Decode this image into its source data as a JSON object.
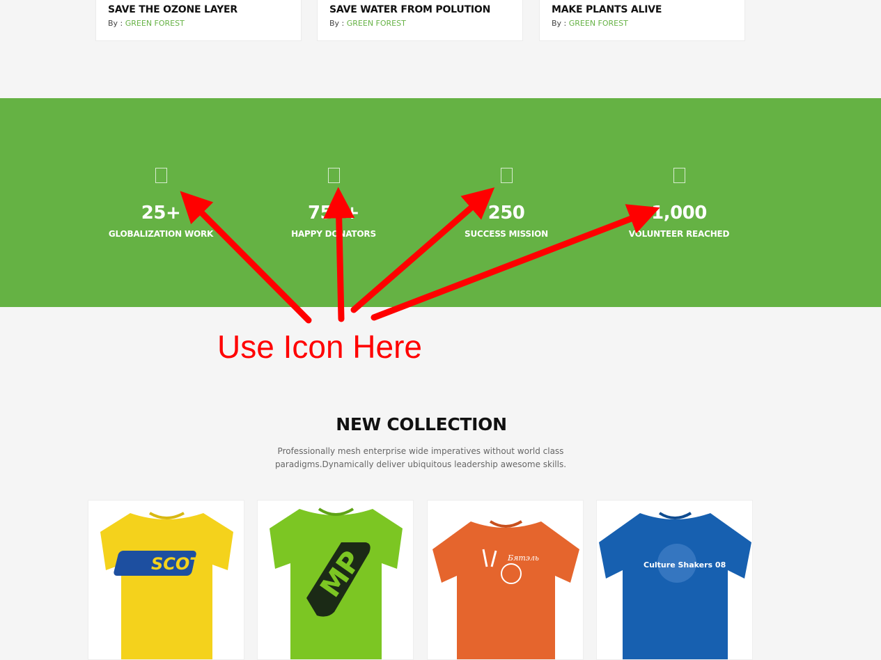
{
  "cards": [
    {
      "title": "SAVE THE OZONE LAYER",
      "by": "By :",
      "author": "GREEN FOREST"
    },
    {
      "title": "SAVE WATER FROM POLUTION",
      "by": "By :",
      "author": "GREEN FOREST"
    },
    {
      "title": "MAKE PLANTS ALIVE",
      "by": "By :",
      "author": "GREEN FOREST"
    }
  ],
  "counters": [
    {
      "value": "25+",
      "label": "GLOBALIZATION WORK",
      "icon": "missing-icon"
    },
    {
      "value": "750+",
      "label": "HAPPY DONATORS",
      "icon": "missing-icon"
    },
    {
      "value": "250",
      "label": "SUCCESS MISSION",
      "icon": "missing-icon"
    },
    {
      "value": "1,000",
      "label": "VOLUNTEER REACHED",
      "icon": "missing-icon"
    }
  ],
  "annotation": {
    "text": "Use Icon Here",
    "color": "#ff0000"
  },
  "collection": {
    "title": "NEW COLLECTION",
    "description": "Professionally mesh enterprise wide imperatives without world class paradigms.Dynamically deliver ubiquitous leadership awesome skills.",
    "products": [
      {
        "name": "yellow-tshirt",
        "color": "#f4d21c",
        "print": "SCOTT"
      },
      {
        "name": "green-tshirt",
        "color": "#7cc623",
        "print": "MP"
      },
      {
        "name": "orange-tshirt",
        "color": "#e5652d",
        "print": "Бятэль"
      },
      {
        "name": "blue-tshirt",
        "color": "#1760b0",
        "print": "Culture Shakers 08"
      }
    ]
  },
  "colors": {
    "brand_green": "#65b244",
    "link_green": "#66b245"
  }
}
